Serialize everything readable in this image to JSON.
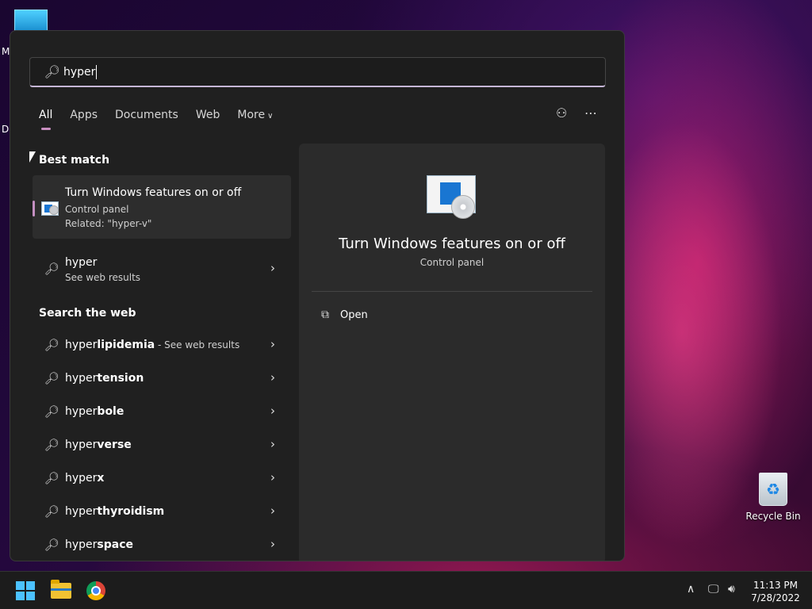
{
  "desktop": {
    "label_m": "M",
    "label_d": "D",
    "recycle_bin_label": "Recycle Bin"
  },
  "search": {
    "value": "hyper",
    "icon": "search-icon"
  },
  "tabs": [
    {
      "label": "All",
      "active": true
    },
    {
      "label": "Apps"
    },
    {
      "label": "Documents"
    },
    {
      "label": "Web"
    },
    {
      "label": "More"
    }
  ],
  "best_match": {
    "heading": "Best match",
    "title": "Turn Windows features on or off",
    "subtitle": "Control panel",
    "related": "Related: \"hyper-v\""
  },
  "web_result": {
    "query": "hyper",
    "subtitle": "See web results"
  },
  "search_web": {
    "heading": "Search the web",
    "items": [
      {
        "prefix": "hyper",
        "suffix": "lipidemia",
        "extra": " - See web results"
      },
      {
        "prefix": "hyper",
        "suffix": "tension"
      },
      {
        "prefix": "hyper",
        "suffix": "bole"
      },
      {
        "prefix": "hyper",
        "suffix": "verse"
      },
      {
        "prefix": "hyper",
        "suffix": "x"
      },
      {
        "prefix": "hyper",
        "suffix": "thyroidism"
      },
      {
        "prefix": "hyper",
        "suffix": "space"
      }
    ]
  },
  "detail": {
    "title": "Turn Windows features on or off",
    "subtitle": "Control panel",
    "action_open": "Open"
  },
  "taskbar": {
    "time": "11:13 PM",
    "date": "7/28/2022"
  },
  "colors": {
    "accent": "#c88fc0",
    "panel": "#202020",
    "detail_panel": "#2b2b2b"
  }
}
